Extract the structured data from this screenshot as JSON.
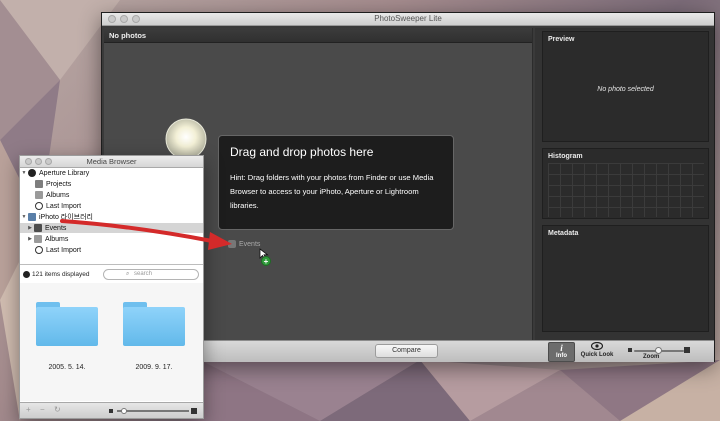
{
  "main_window": {
    "title": "PhotoSweeper Lite",
    "photo_header": "No photos",
    "hint": {
      "title": "Drag and drop photos here",
      "text": "Hint: Drag folders with your photos from Finder or use Media Browser to access to your iPhoto, Aperture or Lightroom libraries."
    },
    "drag_item": "Events",
    "panels": {
      "preview": {
        "label": "Preview",
        "empty_text": "No photo selected"
      },
      "histogram": {
        "label": "Histogram"
      },
      "metadata": {
        "label": "Metadata"
      }
    },
    "toolbar": {
      "compare": "Compare",
      "info": "Info",
      "quick_look": "Quick Look",
      "zoom": "Zoom"
    }
  },
  "media_browser": {
    "title": "Media Browser",
    "tree": [
      {
        "label": "Aperture Library",
        "level": 0,
        "expanded": true
      },
      {
        "label": "Projects",
        "level": 1
      },
      {
        "label": "Albums",
        "level": 1
      },
      {
        "label": "Last Import",
        "level": 1
      },
      {
        "label": "iPhoto 라이브러리",
        "level": 0,
        "expanded": true
      },
      {
        "label": "Events",
        "level": 1,
        "selected": true
      },
      {
        "label": "Albums",
        "level": 1
      },
      {
        "label": "Last Import",
        "level": 1
      }
    ],
    "items_count": "121 items displayed",
    "search_placeholder": "search",
    "folders": [
      "2005. 5. 14.",
      "2009. 9. 17."
    ],
    "colors": {
      "folder": "#6fbfee",
      "selection": "#d5d5d5"
    }
  },
  "colors": {
    "arrow": "#d42a2a",
    "badge": "#2f9a3a"
  }
}
